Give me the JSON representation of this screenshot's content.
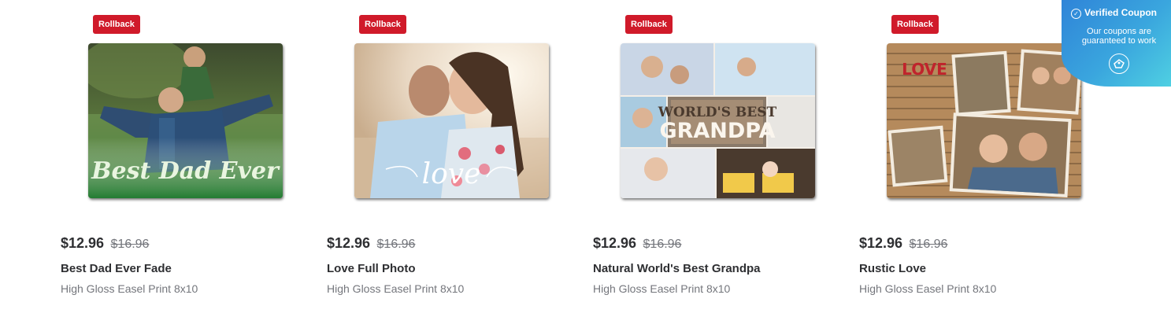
{
  "products": [
    {
      "badge": "Rollback",
      "price": "$12.96",
      "was_price": "$16.96",
      "title": "Best Dad Ever Fade",
      "subtitle": "High Gloss Easel Print 8x10",
      "image_text": "Best Dad Ever"
    },
    {
      "badge": "Rollback",
      "price": "$12.96",
      "was_price": "$16.96",
      "title": "Love Full Photo",
      "subtitle": "High Gloss Easel Print 8x10",
      "image_text": "love"
    },
    {
      "badge": "Rollback",
      "price": "$12.96",
      "was_price": "$16.96",
      "title": "Natural World's Best Grandpa",
      "subtitle": "High Gloss Easel Print 8x10",
      "image_text_top": "WORLD'S BEST",
      "image_text_bottom": "GRANDPA"
    },
    {
      "badge": "Rollback",
      "price": "$12.96",
      "was_price": "$16.96",
      "title": "Rustic Love",
      "subtitle": "High Gloss Easel Print 8x10",
      "image_text": "LOVE"
    }
  ],
  "coupon": {
    "title": "Verified Coupon",
    "body": "Our coupons are guaranteed to work",
    "icon": "coupon-tag-icon"
  },
  "colors": {
    "rollback_red": "#d01a2a",
    "price_text": "#2e2f32",
    "muted_text": "#74767c",
    "coupon_blue": "#3aa6de"
  }
}
